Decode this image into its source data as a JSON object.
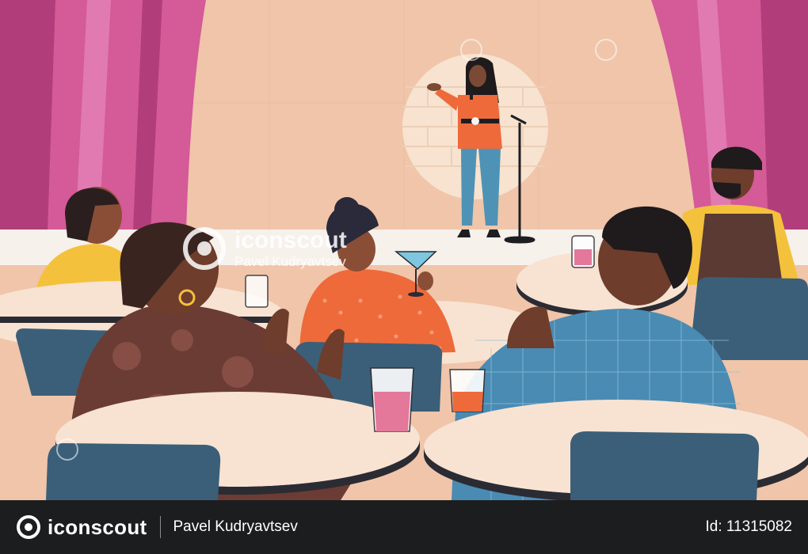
{
  "scene": {
    "description_icons": [
      "spotlight",
      "microphone-stand",
      "curtain",
      "cocktail-glass",
      "drink-glass"
    ]
  },
  "watermark": {
    "brand": "iconscout",
    "author": "Pavel Kudryavtsev"
  },
  "footer": {
    "brand": "iconscout",
    "author": "Pavel Kudryavtsev",
    "id_text": "Id: 11315082"
  },
  "colors": {
    "wall": "#f0c5aa",
    "curtain": "#d45a98",
    "curtain_dark": "#b23d7b",
    "stage_floor": "#f7f1ec",
    "table": "#f8e3d2",
    "chair": "#3b5f78",
    "footer_bg": "#1c1d1f"
  }
}
